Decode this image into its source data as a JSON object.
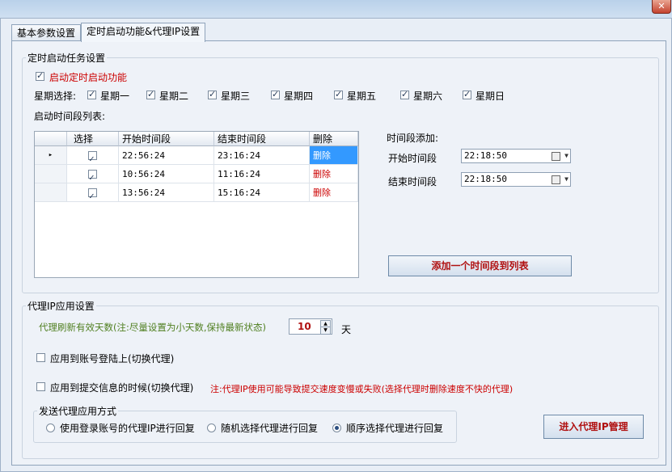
{
  "window": {
    "close_glyph": "✕"
  },
  "tabs": [
    {
      "label": "基本参数设置"
    },
    {
      "label": "定时启动功能&代理IP设置"
    }
  ],
  "schedule": {
    "group_title": "定时启动任务设置",
    "enable_label": "启动定时启动功能",
    "weekday_label": "星期选择:",
    "weekdays": [
      "星期一",
      "星期二",
      "星期三",
      "星期四",
      "星期五",
      "星期六",
      "星期日"
    ],
    "list_label": "启动时间段列表:",
    "table": {
      "headers": [
        "选择",
        "开始时间段",
        "结束时间段",
        "删除"
      ],
      "rows": [
        {
          "start": "22:56:24",
          "end": "23:16:24",
          "delete": "删除"
        },
        {
          "start": "10:56:24",
          "end": "11:16:24",
          "delete": "删除"
        },
        {
          "start": "13:56:24",
          "end": "15:16:24",
          "delete": "删除"
        }
      ],
      "row_pointer_glyph": "▸"
    },
    "add_title": "时间段添加:",
    "start_label": "开始时间段",
    "start_value": "22:18:50",
    "end_label": "结束时间段",
    "end_value": "22:18:50",
    "add_button": "添加一个时间段到列表"
  },
  "proxy": {
    "group_title": "代理IP应用设置",
    "refresh_label": "代理刷新有效天数(注:尽量设置为小天数,保持最新状态)",
    "refresh_value": "10",
    "refresh_unit": "天",
    "apply_login_label": "应用到账号登陆上(切换代理)",
    "apply_submit_label": "应用到提交信息的时候(切换代理)",
    "warning": "注:代理IP使用可能导致提交速度变慢或失败(选择代理时删除速度不快的代理)",
    "mode_title": "发送代理应用方式",
    "modes": [
      "使用登录账号的代理IP进行回复",
      "随机选择代理进行回复",
      "顺序选择代理进行回复"
    ],
    "manage_button": "进入代理IP管理"
  },
  "colors": {
    "accent_red": "#cc0000",
    "label_green": "#4f7f1f",
    "selection_blue": "#3399ff"
  }
}
